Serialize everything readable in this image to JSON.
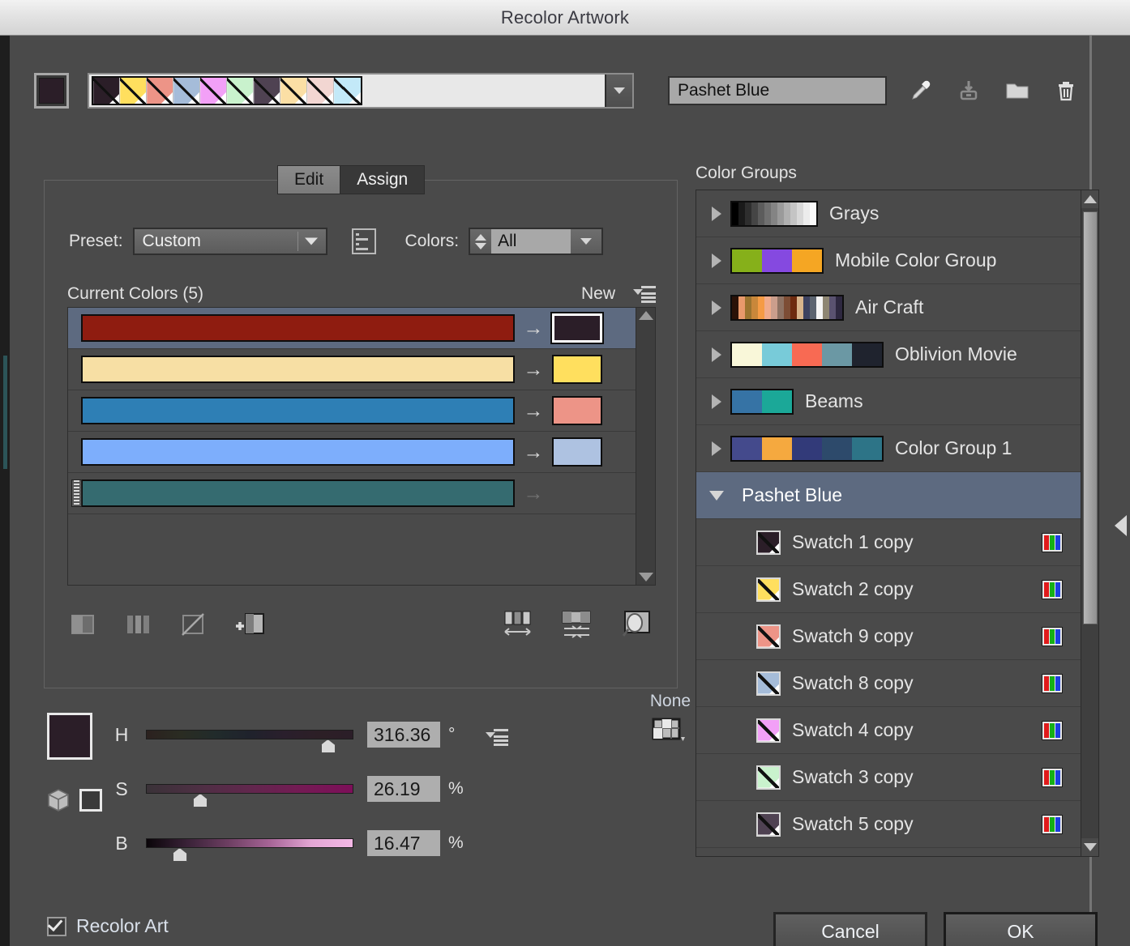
{
  "window": {
    "title": "Recolor Artwork"
  },
  "top": {
    "active_color": "#2b1e28",
    "swatch_strip": [
      {
        "name": "swatch-1",
        "color": "#2b1e28"
      },
      {
        "name": "swatch-2",
        "color": "#ffdf5e"
      },
      {
        "name": "swatch-9",
        "color": "#ed9487"
      },
      {
        "name": "swatch-8",
        "color": "#a5bcd9"
      },
      {
        "name": "swatch-4",
        "color": "#f2a0f7"
      },
      {
        "name": "swatch-3",
        "color": "#c9f2cd"
      },
      {
        "name": "swatch-5",
        "color": "#4f4252"
      },
      {
        "name": "swatch-6",
        "color": "#fbdfa5"
      },
      {
        "name": "swatch-7",
        "color": "#f2d6d2"
      },
      {
        "name": "swatch-10",
        "color": "#c3e9f8"
      }
    ],
    "group_name_value": "Pashet Blue",
    "icons": [
      {
        "name": "eyedropper-icon",
        "label": "Eyedropper"
      },
      {
        "name": "save-color-group-icon",
        "label": "Save color group"
      },
      {
        "name": "new-color-group-folder-icon",
        "label": "New color group"
      },
      {
        "name": "delete-color-group-trash-icon",
        "label": "Delete color group"
      }
    ]
  },
  "tabs": [
    {
      "label": "Edit",
      "active": false
    },
    {
      "label": "Assign",
      "active": true
    }
  ],
  "assign_panel": {
    "preset_label": "Preset:",
    "preset_value": "Custom",
    "color_reduction_options_icon": "color-reduction-options-icon",
    "colors_label": "Colors:",
    "colors_value": "All",
    "current_colors_title": "Current Colors (5)",
    "new_label": "New",
    "panel_menu_icon": "panel-menu-icon",
    "rows": [
      {
        "current": "#8f1c10",
        "new": "#2b1e28",
        "selected": true,
        "has_new": true,
        "has_handle": false
      },
      {
        "current": "#f7dfa4",
        "new": "#ffdf5e",
        "selected": false,
        "has_new": true,
        "has_handle": false
      },
      {
        "current": "#2e7fb5",
        "new": "#ed9487",
        "selected": false,
        "has_new": true,
        "has_handle": false
      },
      {
        "current": "#7daefc",
        "new": "#aec2e1",
        "selected": false,
        "has_new": true,
        "has_handle": false
      },
      {
        "current": "#356b70",
        "new": null,
        "selected": false,
        "has_new": false,
        "has_handle": true
      }
    ],
    "arrow_glyph": "→",
    "tools_left": [
      {
        "name": "merge-colors-icon"
      },
      {
        "name": "separate-colors-icon"
      },
      {
        "name": "exclude-color-icon"
      },
      {
        "name": "add-color-row-icon"
      }
    ],
    "tools_right": [
      {
        "name": "randomize-saturation-brightness-icon"
      },
      {
        "name": "randomize-color-order-icon"
      },
      {
        "name": "color-mode-preview-icon"
      }
    ]
  },
  "hsb": {
    "preview_color": "#2b1e28",
    "color-mode-cube-icon": "color-mode-cube-icon",
    "out_of_gamut_box": "#3a3a3a",
    "menu_icon": "hsb-menu-icon",
    "sliders": [
      {
        "channel": "H",
        "value": "316.36",
        "unit": "°",
        "pos_pct": 88
      },
      {
        "channel": "S",
        "value": "26.19",
        "unit": "%",
        "pos_pct": 26
      },
      {
        "channel": "B",
        "value": "16.47",
        "unit": "%",
        "pos_pct": 16
      }
    ],
    "none_label": "None",
    "limit_library_icon": "limit-color-library-icon"
  },
  "color_groups": {
    "title": "Color Groups",
    "groups": [
      {
        "label": "Grays",
        "expanded": false,
        "selected": false,
        "colors": [
          "#000000",
          "#1a1a1a",
          "#2e2e2e",
          "#454545",
          "#5c5c5c",
          "#707070",
          "#848484",
          "#9a9a9a",
          "#b0b0b0",
          "#c4c4c4",
          "#d8d8d8",
          "#ececec",
          "#fafafa"
        ]
      },
      {
        "label": "Mobile Color Group",
        "expanded": false,
        "selected": false,
        "colors": [
          "#86b01a",
          "#8549e0",
          "#f5a623"
        ]
      },
      {
        "label": "Air Craft",
        "expanded": false,
        "selected": false,
        "colors": [
          "#2a1208",
          "#e8996c",
          "#9c7430",
          "#c9873a",
          "#f59b45",
          "#f0ab8b",
          "#cb9e8c",
          "#8e7263",
          "#7d4d35",
          "#6e2b10",
          "#d8b48c",
          "#3d4260",
          "#5c6470",
          "#f5f5f5",
          "#8e8673",
          "#5a5270",
          "#2e2840"
        ]
      },
      {
        "label": "Oblivion Movie",
        "expanded": false,
        "selected": false,
        "colors": [
          "#f9f7d9",
          "#78cbd9",
          "#f86a53",
          "#6b98a4",
          "#1f232e"
        ]
      },
      {
        "label": "Beams",
        "expanded": false,
        "selected": false,
        "colors": [
          "#3673a5",
          "#1ba898"
        ]
      },
      {
        "label": "Color Group 1",
        "expanded": false,
        "selected": false,
        "colors": [
          "#444a8c",
          "#f5a93f",
          "#323a79",
          "#2d4a6b",
          "#2d7487"
        ]
      },
      {
        "label": "Pashet Blue",
        "expanded": true,
        "selected": true,
        "colors": []
      }
    ],
    "swatches": [
      {
        "label": "Swatch 1 copy",
        "color": "#2b1e28",
        "mode": "RGB"
      },
      {
        "label": "Swatch 2 copy",
        "color": "#ffdf5e",
        "mode": "RGB"
      },
      {
        "label": "Swatch 9 copy",
        "color": "#ed9487",
        "mode": "RGB"
      },
      {
        "label": "Swatch 8 copy",
        "color": "#a5bcd9",
        "mode": "RGB"
      },
      {
        "label": "Swatch 4 copy",
        "color": "#f2a0f7",
        "mode": "RGB"
      },
      {
        "label": "Swatch 3 copy",
        "color": "#c9f2cd",
        "mode": "RGB"
      },
      {
        "label": "Swatch 5 copy",
        "color": "#4f4252",
        "mode": "RGB"
      }
    ]
  },
  "footer": {
    "recolor_art_label": "Recolor Art",
    "recolor_art_checked": true,
    "cancel_label": "Cancel",
    "ok_label": "OK"
  }
}
